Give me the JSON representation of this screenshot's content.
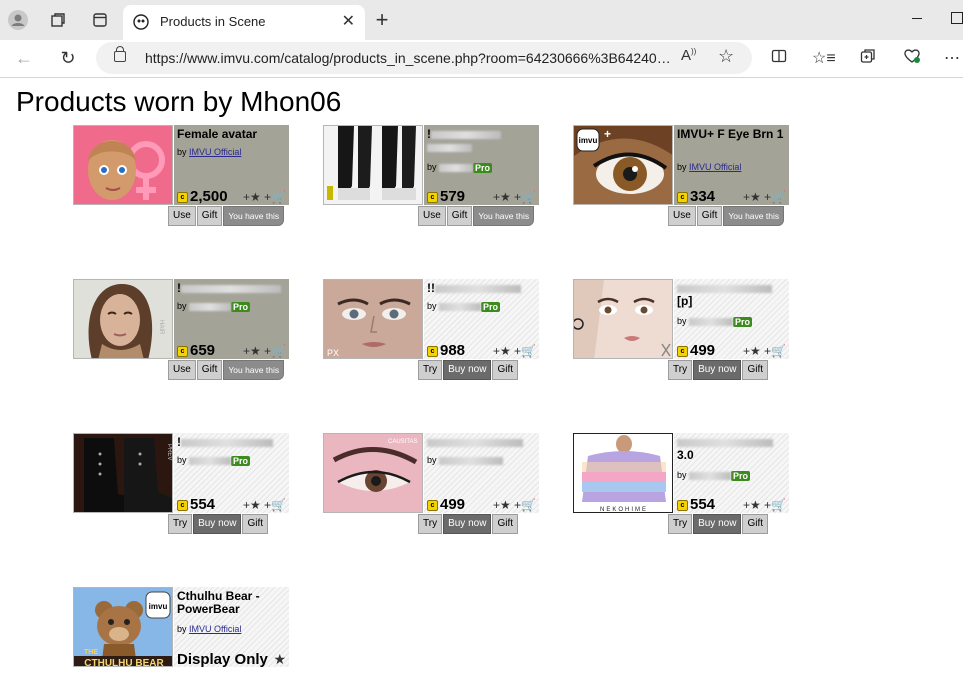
{
  "browser": {
    "tab_title": "Products in Scene",
    "url": "https://www.imvu.com/catalog/products_in_scene.php?room=64230666%3B64240…",
    "reader_label": "A"
  },
  "page": {
    "title": "Products worn by Mhon06"
  },
  "products": [
    {
      "name": "Female avatar",
      "by": "by",
      "creator": "IMVU Official",
      "price": "2,500",
      "pro": false,
      "actions": [
        "Use",
        "Gift",
        "You have this"
      ]
    },
    {
      "name": "!",
      "by": "by",
      "creator": "",
      "price": "579",
      "pro": true,
      "pro_label": "Pro",
      "actions": [
        "Use",
        "Gift",
        "You have this"
      ]
    },
    {
      "name": "IMVU+ F Eye Brn 1",
      "by": "by",
      "creator": "IMVU Official",
      "price": "334",
      "pro": false,
      "actions": [
        "Use",
        "Gift",
        "You have this"
      ]
    },
    {
      "name": "!",
      "by": "by",
      "creator": "",
      "price": "659",
      "pro": true,
      "pro_label": "Pro",
      "actions": [
        "Use",
        "Gift",
        "You have this"
      ]
    },
    {
      "name": "!!",
      "by": "by",
      "creator": "",
      "price": "988",
      "pro": true,
      "pro_label": "Pro",
      "actions": [
        "Try",
        "Buy now",
        "Gift"
      ]
    },
    {
      "name": "[p]",
      "by": "by",
      "creator": "",
      "price": "499",
      "pro": true,
      "pro_label": "Pro",
      "actions": [
        "Try",
        "Buy now",
        "Gift"
      ]
    },
    {
      "name": "!",
      "by": "by",
      "creator": "",
      "price": "554",
      "pro": true,
      "pro_label": "Pro",
      "actions": [
        "Try",
        "Buy now",
        "Gift"
      ]
    },
    {
      "name": "",
      "by": "by",
      "creator": "",
      "price": "499",
      "pro": false,
      "actions": [
        "Try",
        "Buy now",
        "Gift"
      ]
    },
    {
      "name": "3.0",
      "by": "by",
      "creator": "",
      "price": "554",
      "pro": true,
      "pro_label": "Pro",
      "actions": [
        "Try",
        "Buy now",
        "Gift"
      ]
    },
    {
      "name": "Cthulhu Bear - PowerBear",
      "by": "by",
      "creator": "IMVU Official",
      "price": "",
      "display_only": "Display Only",
      "pro": false,
      "actions": []
    }
  ],
  "thumb_labels": {
    "nekohime": "NEKOHIME",
    "cthulhu": "CTHULHU BEAR",
    "the": "THE",
    "px": "PX",
    "cauditas": "CAUSITAS"
  },
  "colors": {
    "accent_green": "#3d8a1e",
    "info_bg": "#a3a398",
    "coin": "#f3d400"
  }
}
